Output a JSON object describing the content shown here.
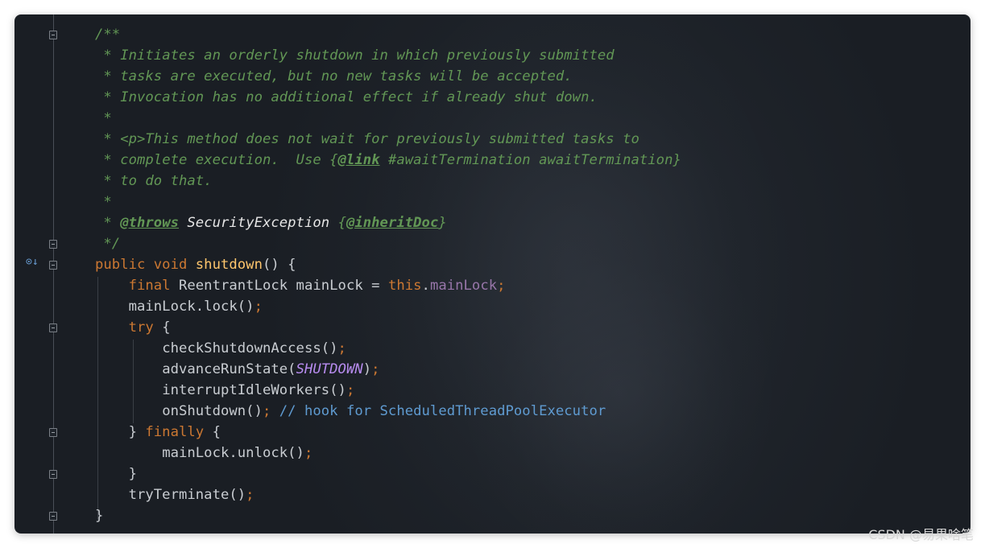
{
  "editor": {
    "lines": [
      {
        "indent": "",
        "tokens": [
          {
            "t": "doc",
            "s": "/**"
          }
        ]
      },
      {
        "indent": " ",
        "tokens": [
          {
            "t": "doc",
            "s": "* Initiates an orderly shutdown in which previously submitted"
          }
        ]
      },
      {
        "indent": " ",
        "tokens": [
          {
            "t": "doc",
            "s": "* tasks are executed, but no new tasks will be accepted."
          }
        ]
      },
      {
        "indent": " ",
        "tokens": [
          {
            "t": "doc",
            "s": "* Invocation has no additional effect if already shut down."
          }
        ]
      },
      {
        "indent": " ",
        "tokens": [
          {
            "t": "doc",
            "s": "*"
          }
        ]
      },
      {
        "indent": " ",
        "tokens": [
          {
            "t": "doc",
            "s": "* <p>This method does not wait for previously submitted tasks to"
          }
        ]
      },
      {
        "indent": " ",
        "tokens": [
          {
            "t": "doc",
            "s": "* complete execution.  Use {"
          },
          {
            "t": "doctag",
            "s": "@link"
          },
          {
            "t": "doc",
            "s": " #awaitTermination awaitTermination}"
          }
        ]
      },
      {
        "indent": " ",
        "tokens": [
          {
            "t": "doc",
            "s": "* to do that."
          }
        ]
      },
      {
        "indent": " ",
        "tokens": [
          {
            "t": "doc",
            "s": "*"
          }
        ]
      },
      {
        "indent": " ",
        "tokens": [
          {
            "t": "doc",
            "s": "* "
          },
          {
            "t": "doctag",
            "s": "@throws"
          },
          {
            "t": "doc",
            "s": " "
          },
          {
            "t": "docw",
            "s": "SecurityException"
          },
          {
            "t": "doc",
            "s": " {"
          },
          {
            "t": "doctag",
            "s": "@inheritDoc"
          },
          {
            "t": "doc",
            "s": "}"
          }
        ]
      },
      {
        "indent": " ",
        "tokens": [
          {
            "t": "doc",
            "s": "*/"
          }
        ]
      },
      {
        "indent": "",
        "tokens": [
          {
            "t": "kw",
            "s": "public void "
          },
          {
            "t": "fn",
            "s": "shutdown"
          },
          {
            "t": "pl",
            "s": "() {"
          }
        ]
      },
      {
        "indent": "    ",
        "tokens": [
          {
            "t": "kw",
            "s": "final "
          },
          {
            "t": "pl",
            "s": "ReentrantLock mainLock = "
          },
          {
            "t": "kw",
            "s": "this"
          },
          {
            "t": "pl",
            "s": "."
          },
          {
            "t": "fld",
            "s": "mainLock"
          },
          {
            "t": "kw",
            "s": ";"
          }
        ]
      },
      {
        "indent": "    ",
        "tokens": [
          {
            "t": "pl",
            "s": "mainLock.lock()"
          },
          {
            "t": "kw",
            "s": ";"
          }
        ]
      },
      {
        "indent": "    ",
        "tokens": [
          {
            "t": "kw",
            "s": "try "
          },
          {
            "t": "pl",
            "s": "{"
          }
        ]
      },
      {
        "indent": "        ",
        "tokens": [
          {
            "t": "pl",
            "s": "checkShutdownAccess()"
          },
          {
            "t": "kw",
            "s": ";"
          }
        ]
      },
      {
        "indent": "        ",
        "tokens": [
          {
            "t": "pl",
            "s": "advanceRunState("
          },
          {
            "t": "cst",
            "s": "SHUTDOWN"
          },
          {
            "t": "pl",
            "s": ")"
          },
          {
            "t": "kw",
            "s": ";"
          }
        ]
      },
      {
        "indent": "        ",
        "tokens": [
          {
            "t": "pl",
            "s": "interruptIdleWorkers()"
          },
          {
            "t": "kw",
            "s": ";"
          }
        ]
      },
      {
        "indent": "        ",
        "tokens": [
          {
            "t": "pl",
            "s": "onShutdown()"
          },
          {
            "t": "kw",
            "s": "; "
          },
          {
            "t": "cmt",
            "s": "// hook for ScheduledThreadPoolExecutor"
          }
        ]
      },
      {
        "indent": "    ",
        "tokens": [
          {
            "t": "pl",
            "s": "} "
          },
          {
            "t": "kw",
            "s": "finally "
          },
          {
            "t": "pl",
            "s": "{"
          }
        ]
      },
      {
        "indent": "        ",
        "tokens": [
          {
            "t": "pl",
            "s": "mainLock.unlock()"
          },
          {
            "t": "kw",
            "s": ";"
          }
        ]
      },
      {
        "indent": "    ",
        "tokens": [
          {
            "t": "pl",
            "s": "}"
          }
        ]
      },
      {
        "indent": "    ",
        "tokens": [
          {
            "t": "pl",
            "s": "tryTerminate()"
          },
          {
            "t": "kw",
            "s": ";"
          }
        ]
      },
      {
        "indent": "",
        "tokens": [
          {
            "t": "pl",
            "s": "}"
          }
        ]
      }
    ]
  },
  "gutter": {
    "fold_lines": [
      0,
      10,
      11,
      14,
      19,
      21,
      23
    ],
    "override_icon": "override-method-icon"
  },
  "watermark": "CSDN @易果啥笔",
  "colors": {
    "background": "#1f242b",
    "doc_comment": "#629755",
    "keyword": "#cc7832",
    "method_declaration": "#ffc66d",
    "field": "#9876aa",
    "constant": "#b88cf0",
    "line_comment": "#5f9bd1",
    "plain": "#c9cdd2"
  }
}
